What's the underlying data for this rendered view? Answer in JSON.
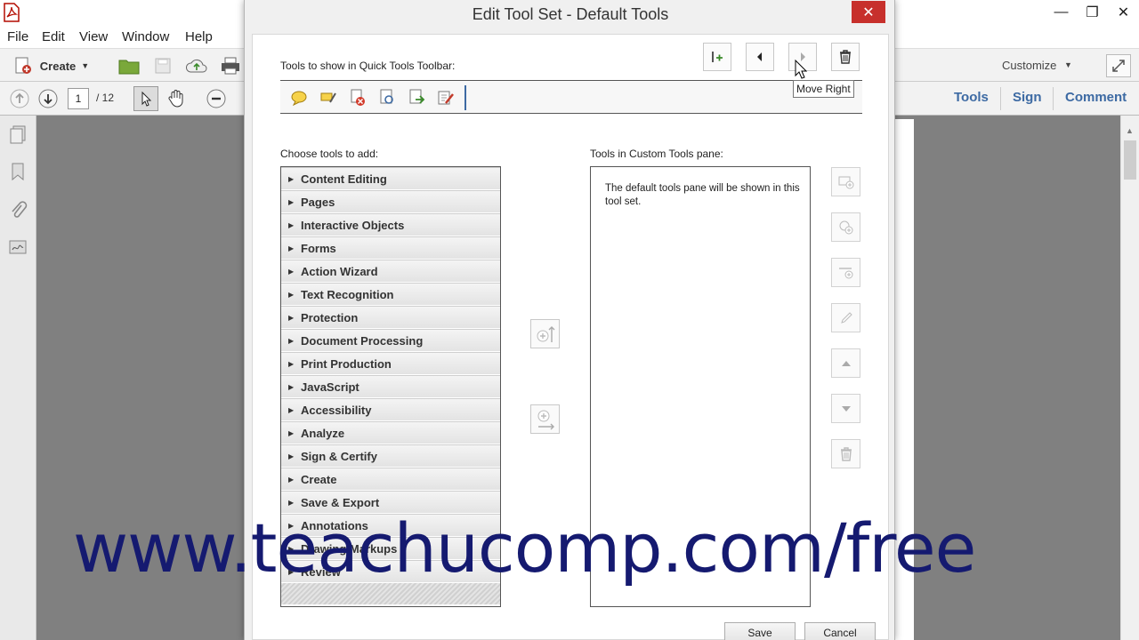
{
  "app": {
    "menu": [
      "File",
      "Edit",
      "View",
      "Window",
      "Help"
    ],
    "toolbar": {
      "create_label": "Create",
      "customize_label": "Customize"
    },
    "nav": {
      "page_value": "1",
      "page_total": "/ 12"
    },
    "right_tabs": [
      "Tools",
      "Sign",
      "Comment"
    ]
  },
  "dialog": {
    "title": "Edit Tool Set - Default Tools",
    "close_glyph": "✕",
    "quick_label": "Tools to show in Quick Tools Toolbar:",
    "tooltip": "Move Right",
    "choose_label": "Choose tools to add:",
    "custom_label": "Tools in Custom Tools pane:",
    "custom_message": "The default tools pane will be shown in this tool set.",
    "categories": [
      "Content Editing",
      "Pages",
      "Interactive Objects",
      "Forms",
      "Action Wizard",
      "Text Recognition",
      "Protection",
      "Document Processing",
      "Print Production",
      "JavaScript",
      "Accessibility",
      "Analyze",
      "Sign & Certify",
      "Create",
      "Save & Export",
      "Annotations",
      "Drawing Markups",
      "Review"
    ],
    "save_label": "Save",
    "cancel_label": "Cancel"
  },
  "watermark": "www.teachucomp.com/free",
  "colors": {
    "accent_blue": "#3d6aa3",
    "watermark": "#151a70",
    "close_red": "#c7302c"
  }
}
